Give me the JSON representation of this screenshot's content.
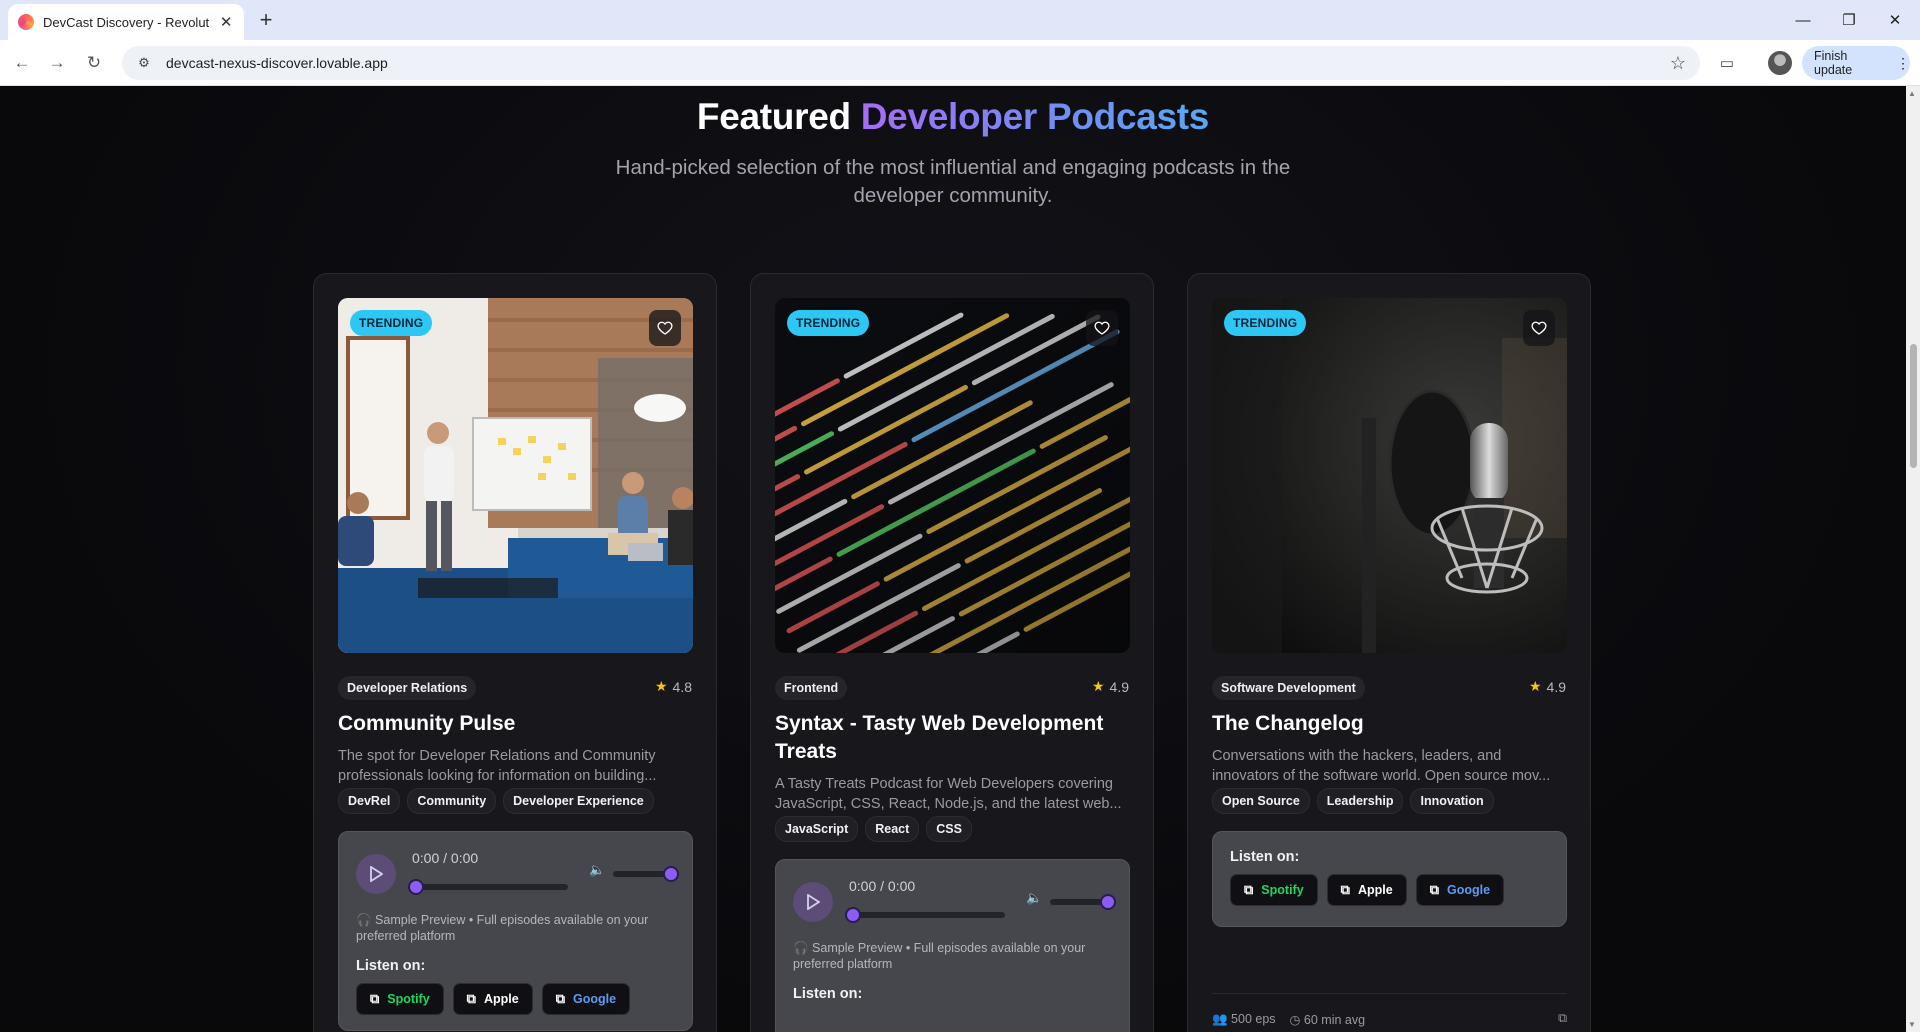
{
  "browser": {
    "tab_title": "DevCast Discovery - Revolution",
    "url": "devcast-nexus-discover.lovable.app",
    "update_label": "Finish update"
  },
  "section": {
    "title_plain": "Featured",
    "title_gradient": "Developer Podcasts",
    "subtitle": "Hand-picked selection of the most influential and engaging podcasts in the developer community."
  },
  "colors": {
    "accent_purple": "#8b5cf6",
    "trending_badge": "#2dc7f3",
    "spotify": "#1ed760",
    "google": "#5b9cf5",
    "star": "#f5c518"
  },
  "cards": [
    {
      "badge": "TRENDING",
      "category": "Developer Relations",
      "rating": "4.8",
      "title": "Community Pulse",
      "description": "The spot for Developer Relations and Community professionals looking for information on building...",
      "tags": [
        "DevRel",
        "Community",
        "Developer Experience"
      ],
      "player": {
        "time": "0:00  /  0:00",
        "preview": "Sample Preview • Full episodes available on your preferred platform"
      },
      "listen_label": "Listen on:",
      "platforms": [
        "Spotify",
        "Apple",
        "Google"
      ]
    },
    {
      "badge": "TRENDING",
      "category": "Frontend",
      "rating": "4.9",
      "title": "Syntax - Tasty Web Development Treats",
      "description": "A Tasty Treats Podcast for Web Developers covering JavaScript, CSS, React, Node.js, and the latest web...",
      "tags": [
        "JavaScript",
        "React",
        "CSS"
      ],
      "player": {
        "time": "0:00  /  0:00",
        "preview": "Sample Preview • Full episodes available on your preferred platform"
      },
      "listen_label": "Listen on:"
    },
    {
      "badge": "TRENDING",
      "category": "Software Development",
      "rating": "4.9",
      "title": "The Changelog",
      "description": "Conversations with the hackers, leaders, and innovators of the software world. Open source mov...",
      "tags": [
        "Open Source",
        "Leadership",
        "Innovation"
      ],
      "listen_label": "Listen on:",
      "platforms": [
        "Spotify",
        "Apple",
        "Google"
      ],
      "episodes": "500 eps",
      "avg_length": "60 min avg"
    }
  ]
}
